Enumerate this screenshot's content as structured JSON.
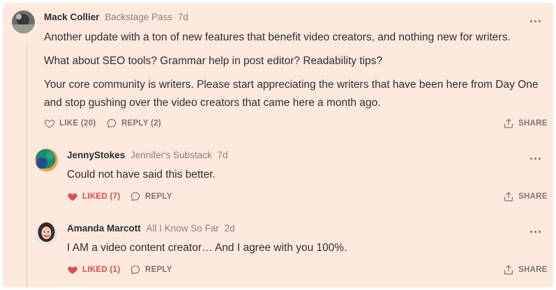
{
  "comments": [
    {
      "author": "Mack Collier",
      "publication": "Backstage Pass",
      "time": "7d",
      "lines": [
        "Another update with a ton of new features that benefit video creators, and nothing new for writers.",
        "What about SEO tools? Grammar help in post editor? Readability tips?",
        "Your core community is writers. Please start appreciating the writers that have been here from Day One",
        "and stop gushing over the video creators that came here a month ago."
      ],
      "like_label": "LIKE (20)",
      "reply_label": "REPLY (2)",
      "share_label": "SHARE"
    },
    {
      "author": "JennyStokes",
      "publication": "Jennifer's Substack",
      "time": "7d",
      "lines": [
        "Could not have said this better."
      ],
      "like_label": "LIKED (7)",
      "reply_label": "REPLY",
      "share_label": "SHARE"
    },
    {
      "author": "Amanda Marcott",
      "publication": "All I Know So Far",
      "time": "2d",
      "lines": [
        "I AM a video content creator… And I agree with you 100%."
      ],
      "like_label": "LIKED (1)",
      "reply_label": "REPLY",
      "share_label": "SHARE"
    }
  ],
  "colors": {
    "background": "#fde9de",
    "liked": "#e04b4b",
    "muted": "#8b7f78"
  },
  "icons": [
    "avatar",
    "more-options-icon",
    "heart-outline-icon",
    "heart-filled-icon",
    "comment-bubble-icon",
    "share-icon"
  ]
}
